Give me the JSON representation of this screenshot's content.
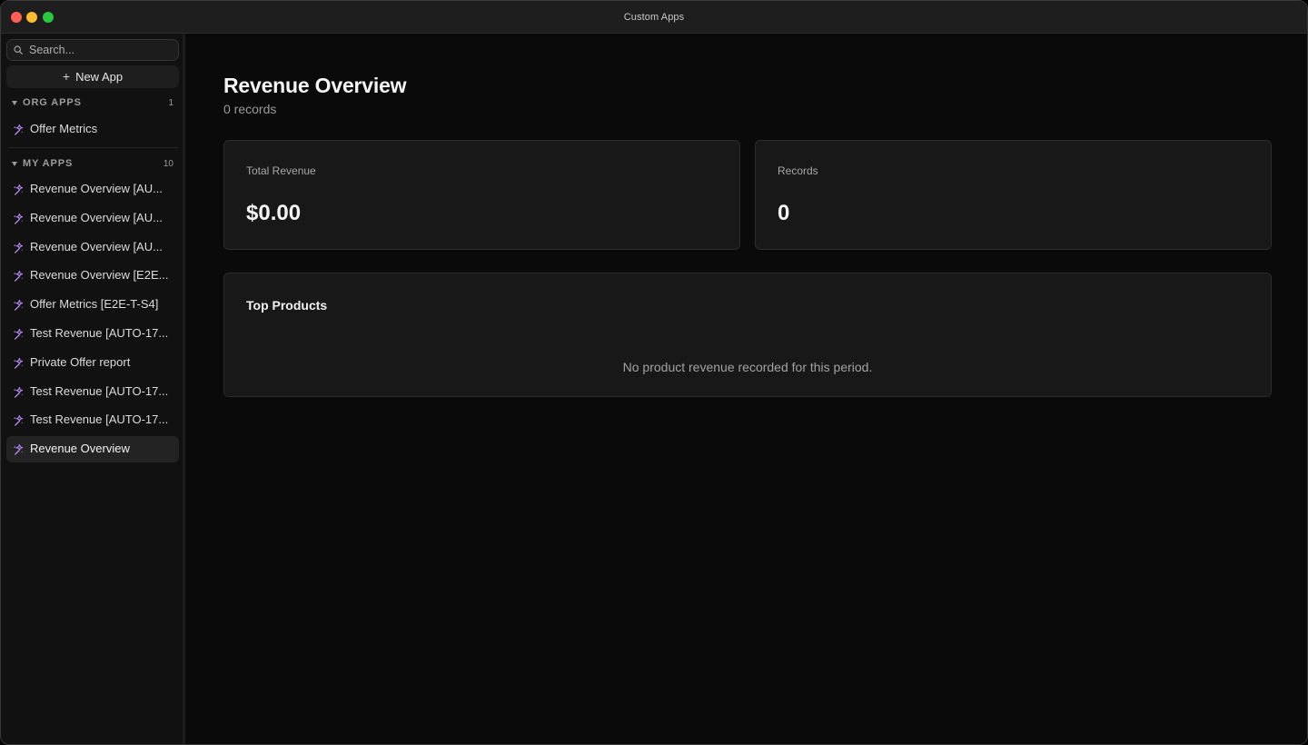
{
  "window": {
    "title": "Custom Apps"
  },
  "sidebar": {
    "search": {
      "placeholder": "Search..."
    },
    "new_app_label": "New App",
    "org_apps": {
      "label": "ORG APPS",
      "count": "1",
      "items": [
        {
          "label": "Offer Metrics"
        }
      ]
    },
    "my_apps": {
      "label": "MY APPS",
      "count": "10",
      "items": [
        {
          "label": "Revenue Overview [AU..."
        },
        {
          "label": "Revenue Overview [AU..."
        },
        {
          "label": "Revenue Overview [AU..."
        },
        {
          "label": "Revenue Overview [E2E..."
        },
        {
          "label": "Offer Metrics [E2E-T-S4]"
        },
        {
          "label": "Test Revenue [AUTO-17..."
        },
        {
          "label": "Private Offer report"
        },
        {
          "label": "Test Revenue [AUTO-17..."
        },
        {
          "label": "Test Revenue [AUTO-17..."
        },
        {
          "label": "Revenue Overview"
        }
      ],
      "active_index": 9
    }
  },
  "main": {
    "title": "Revenue Overview",
    "subtitle": "0 records",
    "stats": [
      {
        "label": "Total Revenue",
        "value": "$0.00"
      },
      {
        "label": "Records",
        "value": "0"
      }
    ],
    "top_products": {
      "title": "Top Products",
      "empty_message": "No product revenue recorded for this period."
    }
  },
  "colors": {
    "accent_icon": "#b98cff",
    "background": "#0a0a0a",
    "sidebar": "#111111",
    "card": "#181818"
  },
  "icons": {
    "app": "sparkles-icon",
    "search": "search-icon",
    "plus": "plus-icon",
    "caret": "caret-down-icon"
  }
}
